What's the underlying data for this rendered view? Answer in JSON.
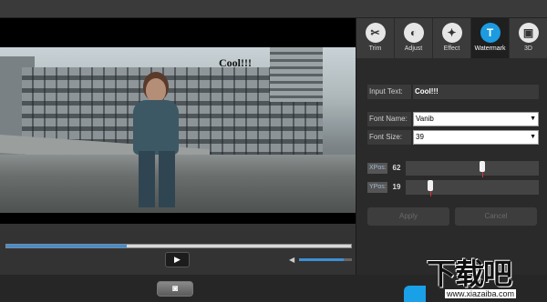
{
  "video": {
    "watermark_text": "Cool!!!",
    "seek_fraction": 0.35,
    "volume_fraction": 0.85
  },
  "controls": {
    "play_icon": "play-icon",
    "snapshot_icon": "camera-icon",
    "volume_icon": "speaker-icon"
  },
  "tabs": [
    {
      "label": "Trim",
      "icon": "scissors-icon",
      "glyph": "✂"
    },
    {
      "label": "Adjust",
      "icon": "brightness-icon",
      "glyph": "◐"
    },
    {
      "label": "Effect",
      "icon": "magic-wand-icon",
      "glyph": "✦"
    },
    {
      "label": "Watermark",
      "icon": "watermark-icon",
      "glyph": "T"
    },
    {
      "label": "3D",
      "icon": "3d-icon",
      "glyph": "▣"
    }
  ],
  "active_tab": "Watermark",
  "form": {
    "input_text_label": "Input Text:",
    "input_text_value": "Cool!!!",
    "font_name_label": "Font Name:",
    "font_name_value": "Vanib",
    "font_size_label": "Font Size:",
    "font_size_value": "39",
    "xpos_label": "XPos:",
    "xpos_value": "62",
    "xpos_fraction": 0.58,
    "ypos_label": "YPos:",
    "ypos_value": "19",
    "ypos_fraction": 0.17,
    "apply_label": "Apply",
    "cancel_label": "Cancel"
  },
  "site_logo": {
    "mark": "下载吧",
    "url": "www.xiazaiba.com"
  },
  "colors": {
    "accent": "#1c9be0",
    "seek": "#3d8fd6",
    "slider_tick": "#dd3333"
  }
}
